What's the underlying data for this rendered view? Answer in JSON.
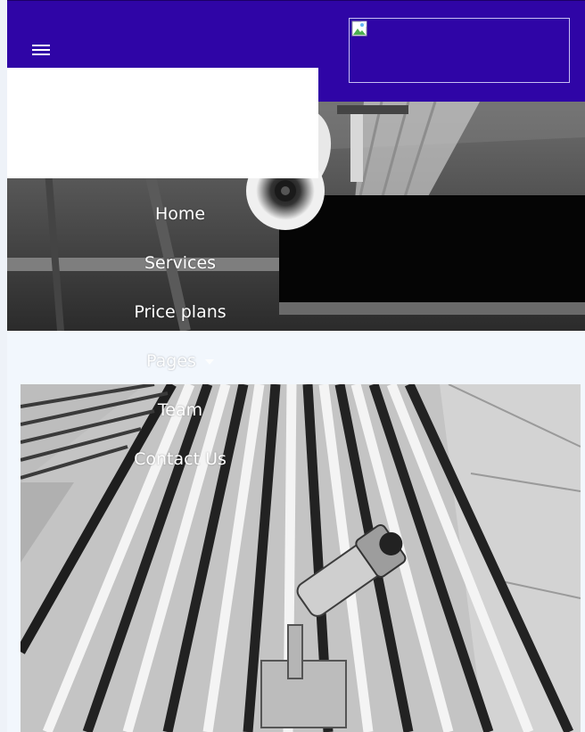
{
  "header": {
    "background": "#2f05a6",
    "menu_icon": "hamburger-menu-icon",
    "logo_icon": "broken-image-icon"
  },
  "nav": {
    "items": [
      {
        "label": "Home"
      },
      {
        "label": "Services"
      },
      {
        "label": "Price plans"
      },
      {
        "label": "Pages",
        "has_dropdown": true,
        "dropdown_icon": "caret-down-icon"
      },
      {
        "label": "Team"
      },
      {
        "label": "Contact Us"
      }
    ]
  },
  "colors": {
    "brand": "#2f05a6",
    "nav_text": "#ffffff",
    "page_background": "#f2f7fd"
  }
}
